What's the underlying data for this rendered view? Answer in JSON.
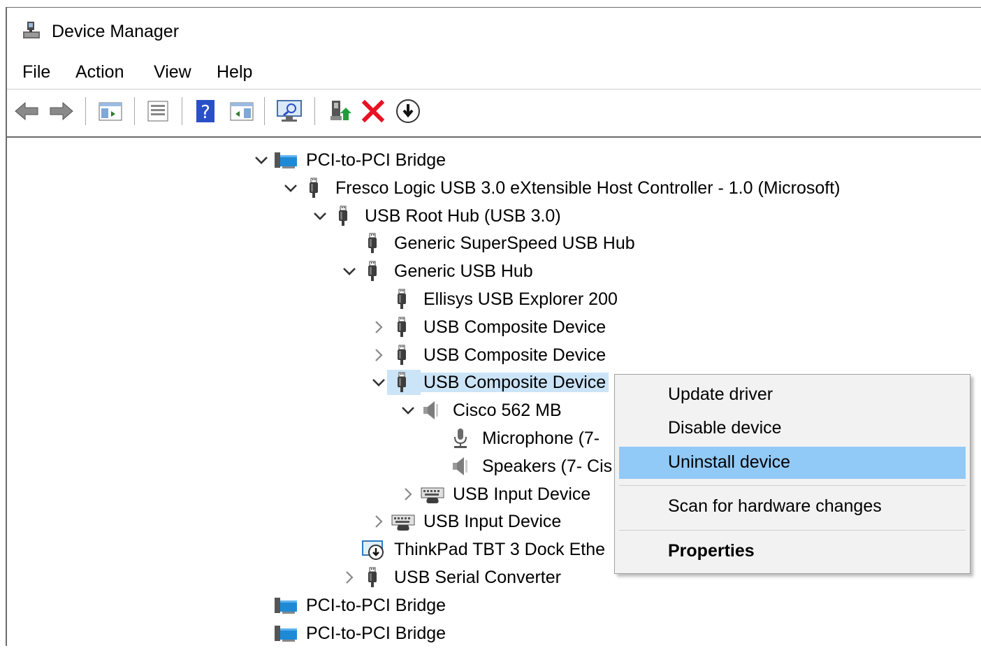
{
  "window": {
    "title": "Device Manager"
  },
  "menu": [
    "File",
    "Action",
    "View",
    "Help"
  ],
  "toolbar": {
    "buttons": [
      "back-icon",
      "forward-icon",
      "show-hide-console-tree-icon",
      "properties-icon",
      "help-icon",
      "action-pane-icon",
      "scan-hardware-icon",
      "update-driver-icon",
      "uninstall-icon",
      "disable-icon"
    ]
  },
  "tree": {
    "rows": [
      {
        "label": "PCI-to-PCI Bridge",
        "icon": "pci-bridge-icon",
        "expander": "expanded"
      },
      {
        "label": "Fresco Logic USB 3.0 eXtensible Host Controller - 1.0 (Microsoft)",
        "icon": "usb-icon",
        "expander": "expanded"
      },
      {
        "label": "USB Root Hub (USB 3.0)",
        "icon": "usb-icon",
        "expander": "expanded"
      },
      {
        "label": "Generic SuperSpeed USB Hub",
        "icon": "usb-icon",
        "expander": "none"
      },
      {
        "label": "Generic USB Hub",
        "icon": "usb-icon",
        "expander": "expanded"
      },
      {
        "label": "Ellisys USB Explorer 200",
        "icon": "usb-icon",
        "expander": "none"
      },
      {
        "label": "USB Composite Device",
        "icon": "usb-icon",
        "expander": "collapsed"
      },
      {
        "label": "USB Composite Device",
        "icon": "usb-icon",
        "expander": "collapsed"
      },
      {
        "label": "USB Composite Device",
        "icon": "usb-icon",
        "expander": "expanded",
        "selected": true
      },
      {
        "label": "Cisco 562 MB",
        "icon": "speaker-icon",
        "expander": "expanded"
      },
      {
        "label": "Microphone (7-",
        "icon": "microphone-icon",
        "expander": "none"
      },
      {
        "label": "Speakers (7- Cis",
        "icon": "speaker-icon",
        "expander": "none"
      },
      {
        "label": "USB Input Device",
        "icon": "hid-icon",
        "expander": "collapsed"
      },
      {
        "label": "USB Input Device",
        "icon": "hid-icon",
        "expander": "collapsed"
      },
      {
        "label": "ThinkPad TBT 3 Dock Ethe",
        "icon": "network-adapter-icon",
        "expander": "none"
      },
      {
        "label": "USB Serial Converter",
        "icon": "usb-icon",
        "expander": "collapsed"
      },
      {
        "label": "PCI-to-PCI Bridge",
        "icon": "pci-bridge-icon",
        "expander": "none"
      },
      {
        "label": "PCI-to-PCI Bridge",
        "icon": "pci-bridge-icon",
        "expander": "none"
      }
    ]
  },
  "context_menu": {
    "items": [
      {
        "label": "Update driver"
      },
      {
        "label": "Disable device"
      },
      {
        "label": "Uninstall device",
        "highlighted": true
      },
      {
        "label": "Scan for hardware changes"
      },
      {
        "label": "Properties",
        "bold": true
      }
    ]
  },
  "colors": {
    "selection": "#cce4f7",
    "menu_highlight": "#91c9f7",
    "delete_red": "#e81123"
  }
}
